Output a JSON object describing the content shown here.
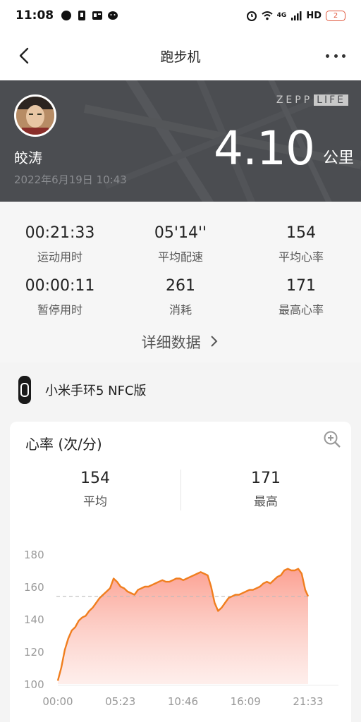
{
  "status_bar": {
    "time": "11:08",
    "network": "4G",
    "hd": "HD",
    "battery": "2"
  },
  "nav": {
    "title": "跑步机"
  },
  "hero": {
    "user_name": "皎涛",
    "date": "2022年6月19日 10:43",
    "brand_left": "ZEPP",
    "brand_right": "LIFE",
    "distance": "4.10",
    "distance_unit": "公里"
  },
  "stats": [
    {
      "value": "00:21:33",
      "label": "运动用时"
    },
    {
      "value": "05'14''",
      "label": "平均配速"
    },
    {
      "value": "154",
      "label": "平均心率"
    },
    {
      "value": "00:00:11",
      "label": "暂停用时"
    },
    {
      "value": "261",
      "label": "消耗"
    },
    {
      "value": "171",
      "label": "最高心率"
    }
  ],
  "details_link": "详细数据",
  "device": {
    "name": "小米手环5 NFC版"
  },
  "heart_rate": {
    "title": "心率 (次/分)",
    "average": {
      "value": "154",
      "label": "平均"
    },
    "max": {
      "value": "171",
      "label": "最高"
    }
  },
  "colors": {
    "line": "#f07e1e",
    "fill_top": "#fba093",
    "accent_badge": "#e0573c"
  },
  "chart_data": {
    "type": "area",
    "title": "",
    "xlabel": "",
    "ylabel": "",
    "x_ticks": [
      "00:00",
      "05:23",
      "10:46",
      "16:09",
      "21:33"
    ],
    "y_ticks": [
      100,
      120,
      140,
      160,
      180
    ],
    "ylim": [
      100,
      180
    ],
    "xlim_minutes": [
      0,
      21.55
    ],
    "average_line": 154,
    "series": [
      {
        "x": [
          0,
          0.3,
          0.6,
          0.9,
          1.2,
          1.5,
          1.8,
          2.1,
          2.4,
          2.7,
          3.0,
          3.3,
          3.6,
          3.9,
          4.2,
          4.5,
          4.8,
          5.1,
          5.4,
          5.7,
          6.0,
          6.3,
          6.6,
          6.9,
          7.2,
          7.5,
          7.8,
          8.1,
          8.4,
          8.7,
          9.0,
          9.3,
          9.6,
          9.9,
          10.2,
          10.5,
          10.8,
          11.1,
          11.4,
          11.7,
          12.0,
          12.3,
          12.6,
          12.9,
          13.2,
          13.5,
          13.8,
          14.1,
          14.4,
          14.7,
          15.0,
          15.3,
          15.6,
          15.9,
          16.2,
          16.5,
          16.8,
          17.1,
          17.4,
          17.7,
          18.0,
          18.3,
          18.6,
          18.9,
          19.2,
          19.5,
          19.8,
          20.1,
          20.4,
          20.7,
          21.0,
          21.3,
          21.55
        ],
        "y": [
          102,
          110,
          121,
          128,
          133,
          135,
          139,
          141,
          142,
          145,
          147,
          150,
          153,
          155,
          157,
          159,
          165,
          163,
          160,
          159,
          157,
          156,
          155,
          158,
          159,
          160,
          160,
          161,
          162,
          163,
          164,
          163,
          163,
          164,
          165,
          165,
          164,
          165,
          166,
          167,
          168,
          169,
          168,
          167,
          160,
          150,
          145,
          147,
          150,
          153,
          154,
          155,
          155,
          156,
          157,
          158,
          158,
          159,
          160,
          162,
          163,
          162,
          164,
          166,
          167,
          170,
          171,
          170,
          170,
          171,
          168,
          158,
          154
        ]
      }
    ]
  }
}
